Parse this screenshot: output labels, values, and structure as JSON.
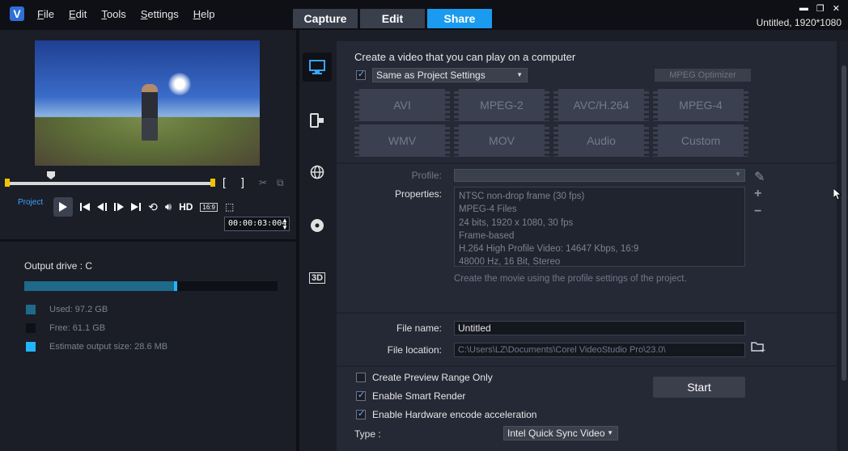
{
  "app": {
    "title_info": "Untitled, 1920*1080",
    "menu": [
      "File",
      "Edit",
      "Tools",
      "Settings",
      "Help"
    ],
    "tabs": [
      "Capture",
      "Edit",
      "Share"
    ],
    "active_tab": "Share"
  },
  "player": {
    "project_label": "Project",
    "hd_label": "HD",
    "aspect_label": "16:9",
    "timecode": "00:00:03:004"
  },
  "output": {
    "title": "Output drive : C",
    "used_fraction": 0.59,
    "estimate_fraction": 0.014,
    "legend": [
      {
        "label": "Used:  97.2 GB",
        "color": "#1f6a8a"
      },
      {
        "label": "Free:  61.1 GB",
        "color": "#0d1016"
      },
      {
        "label": "Estimate output size:  28.6 MB",
        "color": "#22b4ff"
      }
    ]
  },
  "share": {
    "heading": "Create a video that you can play on a computer",
    "same_as_project": "Same as Project Settings",
    "mpeg_optimizer": "MPEG Optimizer",
    "formats": [
      "AVI",
      "MPEG-2",
      "AVC/H.264",
      "MPEG-4",
      "WMV",
      "MOV",
      "Audio",
      "Custom"
    ],
    "profile_label": "Profile:",
    "properties_label": "Properties:",
    "properties": [
      "NTSC non-drop frame (30 fps)",
      "MPEG-4 Files",
      "24 bits, 1920 x 1080, 30 fps",
      "Frame-based",
      "H.264 High Profile Video: 14647 Kbps, 16:9",
      "48000 Hz, 16 Bit, Stereo"
    ],
    "profile_note": "Create the movie using the profile settings of the project.",
    "file_name_label": "File name:",
    "file_name": "Untitled",
    "file_location_label": "File location:",
    "file_location": "C:\\Users\\LZ\\Documents\\Corel VideoStudio Pro\\23.0\\",
    "options": [
      {
        "label": "Create Preview Range Only",
        "checked": false
      },
      {
        "label": "Enable Smart Render",
        "checked": true
      },
      {
        "label": "Enable Hardware encode acceleration",
        "checked": true
      }
    ],
    "type_label": "Type :",
    "type_value": "Intel Quick Sync Video",
    "start_label": "Start"
  }
}
